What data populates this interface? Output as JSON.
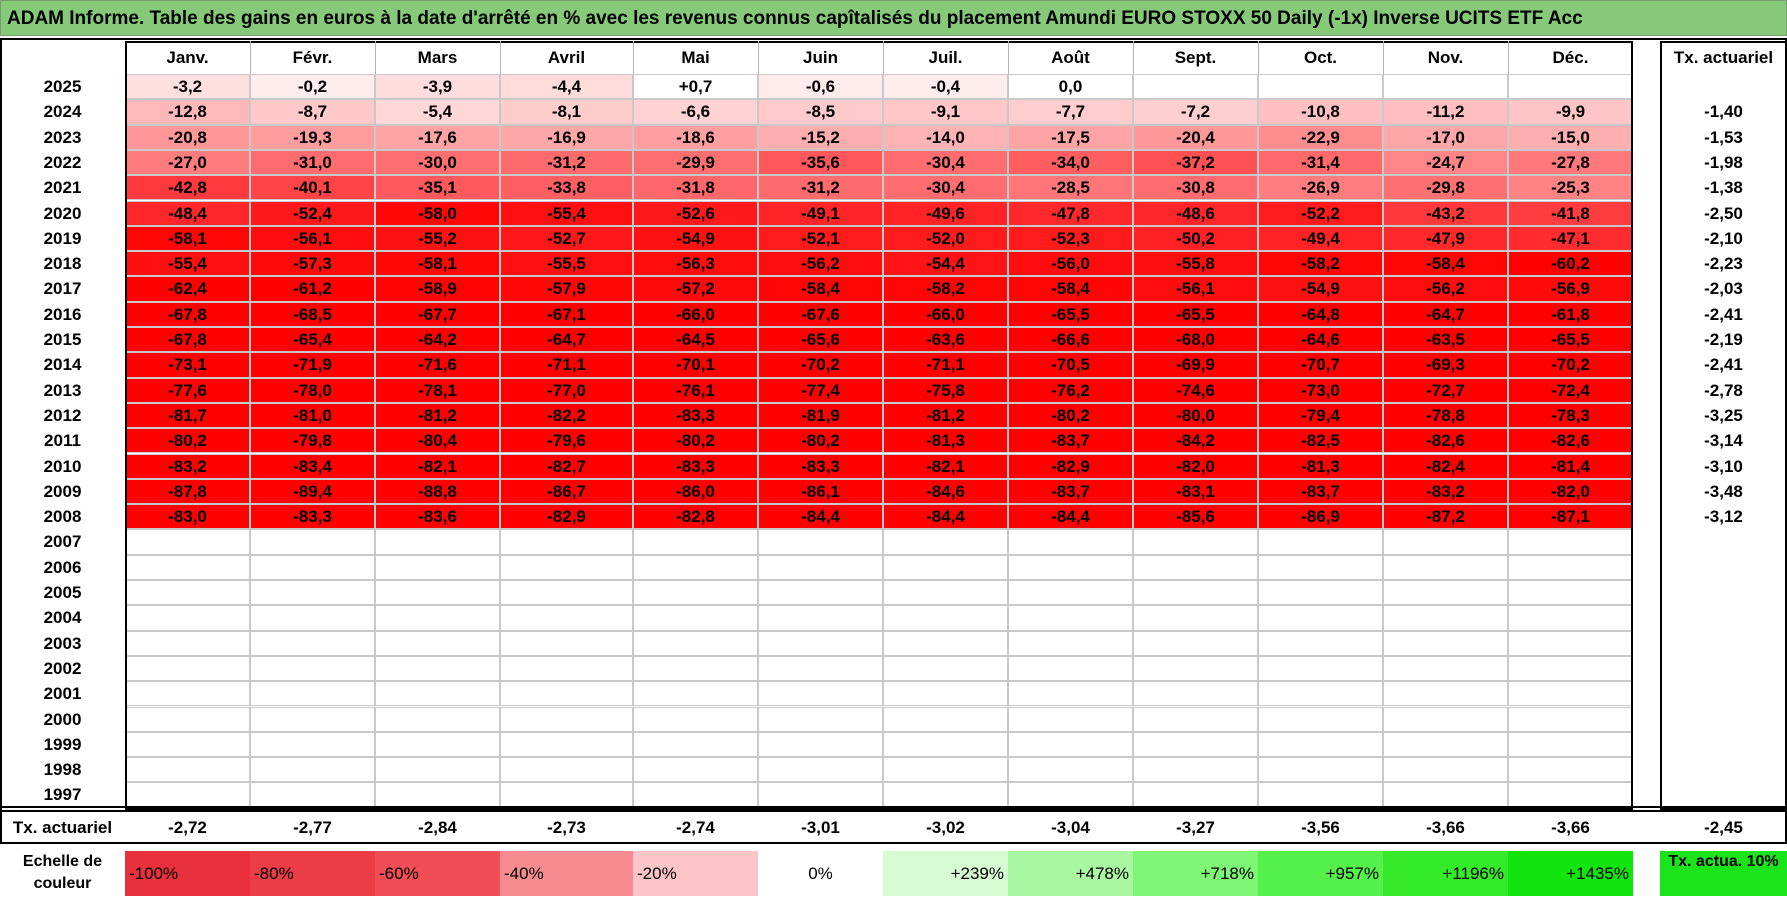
{
  "title": "ADAM Informe. Table des gains en euros à la date d'arrêté en % avec les revenus connus capîtalisés du placement Amundi EURO STOXX 50 Daily (-1x) Inverse UCITS ETF Acc",
  "chart_data": {
    "type": "table",
    "months": [
      "Janv.",
      "Févr.",
      "Mars",
      "Avril",
      "Mai",
      "Juin",
      "Juil.",
      "Août",
      "Sept.",
      "Oct.",
      "Nov.",
      "Déc."
    ],
    "annual_header": "Tx. actuariel",
    "rows": [
      {
        "year": "2025",
        "values": [
          "-3,2",
          "-0,2",
          "-3,9",
          "-4,4",
          "+0,7",
          "-0,6",
          "-0,4",
          "0,0",
          "",
          "",
          "",
          ""
        ],
        "rate": ""
      },
      {
        "year": "2024",
        "values": [
          "-12,8",
          "-8,7",
          "-5,4",
          "-8,1",
          "-6,6",
          "-8,5",
          "-9,1",
          "-7,7",
          "-7,2",
          "-10,8",
          "-11,2",
          "-9,9"
        ],
        "rate": "-1,40"
      },
      {
        "year": "2023",
        "values": [
          "-20,8",
          "-19,3",
          "-17,6",
          "-16,9",
          "-18,6",
          "-15,2",
          "-14,0",
          "-17,5",
          "-20,4",
          "-22,9",
          "-17,0",
          "-15,0"
        ],
        "rate": "-1,53"
      },
      {
        "year": "2022",
        "values": [
          "-27,0",
          "-31,0",
          "-30,0",
          "-31,2",
          "-29,9",
          "-35,6",
          "-30,4",
          "-34,0",
          "-37,2",
          "-31,4",
          "-24,7",
          "-27,8"
        ],
        "rate": "-1,98"
      },
      {
        "year": "2021",
        "values": [
          "-42,8",
          "-40,1",
          "-35,1",
          "-33,8",
          "-31,8",
          "-31,2",
          "-30,4",
          "-28,5",
          "-30,8",
          "-26,9",
          "-29,8",
          "-25,3"
        ],
        "rate": "-1,38"
      },
      {
        "year": "2020",
        "values": [
          "-48,4",
          "-52,4",
          "-58,0",
          "-55,4",
          "-52,6",
          "-49,1",
          "-49,6",
          "-47,8",
          "-48,6",
          "-52,2",
          "-43,2",
          "-41,8"
        ],
        "rate": "-2,50"
      },
      {
        "year": "2019",
        "values": [
          "-58,1",
          "-56,1",
          "-55,2",
          "-52,7",
          "-54,9",
          "-52,1",
          "-52,0",
          "-52,3",
          "-50,2",
          "-49,4",
          "-47,9",
          "-47,1"
        ],
        "rate": "-2,10"
      },
      {
        "year": "2018",
        "values": [
          "-55,4",
          "-57,3",
          "-58,1",
          "-55,5",
          "-56,3",
          "-56,2",
          "-54,4",
          "-56,0",
          "-55,8",
          "-58,2",
          "-58,4",
          "-60,2"
        ],
        "rate": "-2,23"
      },
      {
        "year": "2017",
        "values": [
          "-62,4",
          "-61,2",
          "-58,9",
          "-57,9",
          "-57,2",
          "-58,4",
          "-58,2",
          "-58,4",
          "-56,1",
          "-54,9",
          "-56,2",
          "-56,9"
        ],
        "rate": "-2,03"
      },
      {
        "year": "2016",
        "values": [
          "-67,8",
          "-68,5",
          "-67,7",
          "-67,1",
          "-66,0",
          "-67,6",
          "-66,0",
          "-65,5",
          "-65,5",
          "-64,8",
          "-64,7",
          "-61,8"
        ],
        "rate": "-2,41"
      },
      {
        "year": "2015",
        "values": [
          "-67,8",
          "-65,4",
          "-64,2",
          "-64,7",
          "-64,5",
          "-65,6",
          "-63,6",
          "-66,6",
          "-68,0",
          "-64,6",
          "-63,5",
          "-65,5"
        ],
        "rate": "-2,19"
      },
      {
        "year": "2014",
        "values": [
          "-73,1",
          "-71,9",
          "-71,6",
          "-71,1",
          "-70,1",
          "-70,2",
          "-71,1",
          "-70,5",
          "-69,9",
          "-70,7",
          "-69,3",
          "-70,2"
        ],
        "rate": "-2,41"
      },
      {
        "year": "2013",
        "values": [
          "-77,6",
          "-78,0",
          "-78,1",
          "-77,0",
          "-76,1",
          "-77,4",
          "-75,8",
          "-76,2",
          "-74,6",
          "-73,0",
          "-72,7",
          "-72,4"
        ],
        "rate": "-2,78"
      },
      {
        "year": "2012",
        "values": [
          "-81,7",
          "-81,0",
          "-81,2",
          "-82,2",
          "-83,3",
          "-81,9",
          "-81,2",
          "-80,2",
          "-80,0",
          "-79,4",
          "-78,8",
          "-78,3"
        ],
        "rate": "-3,25"
      },
      {
        "year": "2011",
        "values": [
          "-80,2",
          "-79,8",
          "-80,4",
          "-79,6",
          "-80,2",
          "-80,2",
          "-81,3",
          "-83,7",
          "-84,2",
          "-82,5",
          "-82,6",
          "-82,6"
        ],
        "rate": "-3,14"
      },
      {
        "year": "2010",
        "values": [
          "-83,2",
          "-83,4",
          "-82,1",
          "-82,7",
          "-83,3",
          "-83,3",
          "-82,1",
          "-82,9",
          "-82,0",
          "-81,3",
          "-82,4",
          "-81,4"
        ],
        "rate": "-3,10"
      },
      {
        "year": "2009",
        "values": [
          "-87,8",
          "-89,4",
          "-88,8",
          "-86,7",
          "-86,0",
          "-86,1",
          "-84,6",
          "-83,7",
          "-83,1",
          "-83,7",
          "-83,2",
          "-82,0"
        ],
        "rate": "-3,48"
      },
      {
        "year": "2008",
        "values": [
          "-83,0",
          "-83,3",
          "-83,6",
          "-82,9",
          "-82,8",
          "-84,4",
          "-84,4",
          "-84,4",
          "-85,6",
          "-86,9",
          "-87,2",
          "-87,1"
        ],
        "rate": "-3,12"
      },
      {
        "year": "2007",
        "values": [
          "",
          "",
          "",
          "",
          "",
          "",
          "",
          "",
          "",
          "",
          "",
          ""
        ],
        "rate": ""
      },
      {
        "year": "2006",
        "values": [
          "",
          "",
          "",
          "",
          "",
          "",
          "",
          "",
          "",
          "",
          "",
          ""
        ],
        "rate": ""
      },
      {
        "year": "2005",
        "values": [
          "",
          "",
          "",
          "",
          "",
          "",
          "",
          "",
          "",
          "",
          "",
          ""
        ],
        "rate": ""
      },
      {
        "year": "2004",
        "values": [
          "",
          "",
          "",
          "",
          "",
          "",
          "",
          "",
          "",
          "",
          "",
          ""
        ],
        "rate": ""
      },
      {
        "year": "2003",
        "values": [
          "",
          "",
          "",
          "",
          "",
          "",
          "",
          "",
          "",
          "",
          "",
          ""
        ],
        "rate": ""
      },
      {
        "year": "2002",
        "values": [
          "",
          "",
          "",
          "",
          "",
          "",
          "",
          "",
          "",
          "",
          "",
          ""
        ],
        "rate": ""
      },
      {
        "year": "2001",
        "values": [
          "",
          "",
          "",
          "",
          "",
          "",
          "",
          "",
          "",
          "",
          "",
          ""
        ],
        "rate": ""
      },
      {
        "year": "2000",
        "values": [
          "",
          "",
          "",
          "",
          "",
          "",
          "",
          "",
          "",
          "",
          "",
          ""
        ],
        "rate": ""
      },
      {
        "year": "1999",
        "values": [
          "",
          "",
          "",
          "",
          "",
          "",
          "",
          "",
          "",
          "",
          "",
          ""
        ],
        "rate": ""
      },
      {
        "year": "1998",
        "values": [
          "",
          "",
          "",
          "",
          "",
          "",
          "",
          "",
          "",
          "",
          "",
          ""
        ],
        "rate": ""
      },
      {
        "year": "1997",
        "values": [
          "",
          "",
          "",
          "",
          "",
          "",
          "",
          "",
          "",
          "",
          "",
          ""
        ],
        "rate": ""
      }
    ],
    "footer_label": "Tx. actuariel",
    "footer_values": [
      "-2,72",
      "-2,77",
      "-2,84",
      "-2,73",
      "-2,74",
      "-3,01",
      "-3,02",
      "-3,04",
      "-3,27",
      "-3,56",
      "-3,66",
      "-3,66"
    ],
    "footer_total": "-2,45",
    "scale_label": "Echelle de couleur",
    "scale": [
      {
        "label": "-100%",
        "color": "#e8313c",
        "align": "left"
      },
      {
        "label": "-80%",
        "color": "#ec3d47",
        "align": "left"
      },
      {
        "label": "-60%",
        "color": "#f04d55",
        "align": "left"
      },
      {
        "label": "-40%",
        "color": "#f58a8f",
        "align": "left"
      },
      {
        "label": "-20%",
        "color": "#fbc4c6",
        "align": "left"
      },
      {
        "label": "0%",
        "color": "#ffffff",
        "align": "center"
      },
      {
        "label": "+239%",
        "color": "#d6fbd2",
        "align": "right"
      },
      {
        "label": "+478%",
        "color": "#aaf7a2",
        "align": "right"
      },
      {
        "label": "+718%",
        "color": "#7ef574",
        "align": "right"
      },
      {
        "label": "+957%",
        "color": "#56f04a",
        "align": "right"
      },
      {
        "label": "+1196%",
        "color": "#35ea2a",
        "align": "right"
      },
      {
        "label": "+1435%",
        "color": "#12e40d",
        "align": "right"
      }
    ],
    "scale_note": "Tx. actua. 10%",
    "scale_note_color": "#1be41b"
  }
}
